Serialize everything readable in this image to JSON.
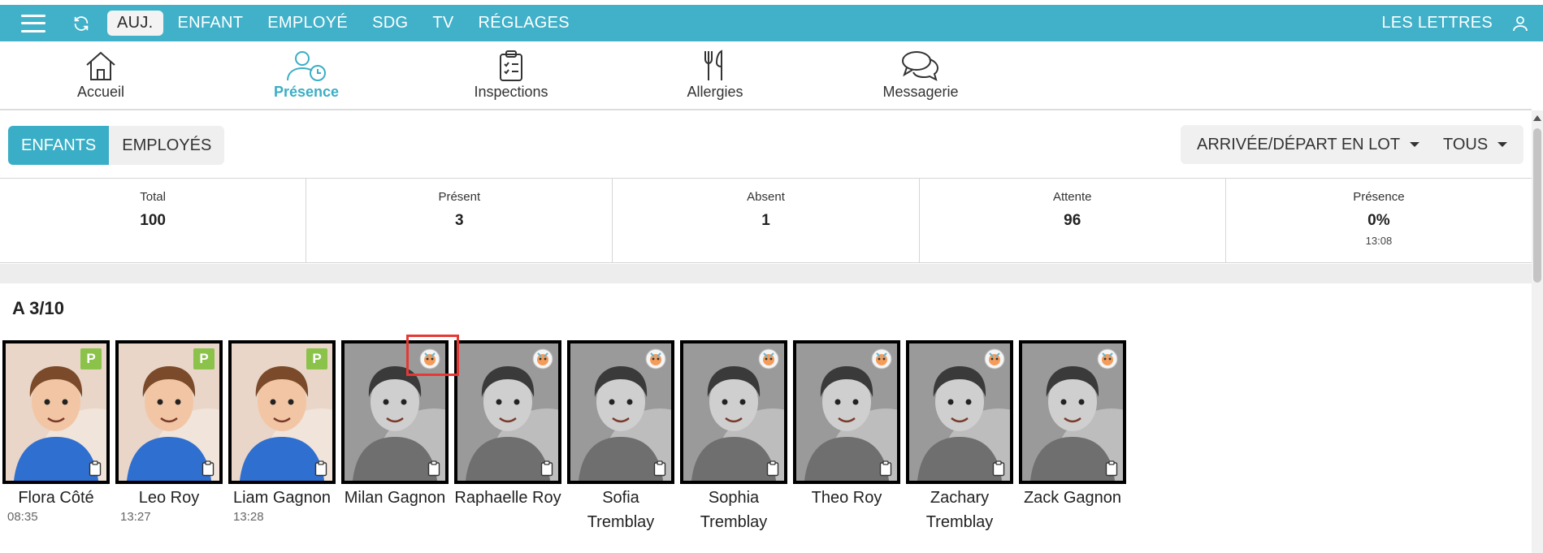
{
  "topbar": {
    "nav": [
      "AUJ.",
      "ENFANT",
      "EMPLOYÉ",
      "SDG",
      "TV",
      "RÉGLAGES"
    ],
    "right_label": "LES LETTRES"
  },
  "modules": [
    {
      "label": "Accueil",
      "icon": "home-icon"
    },
    {
      "label": "Présence",
      "icon": "attendance-icon"
    },
    {
      "label": "Inspections",
      "icon": "clipboard-icon"
    },
    {
      "label": "Allergies",
      "icon": "utensils-icon"
    },
    {
      "label": "Messagerie",
      "icon": "chat-icon"
    }
  ],
  "toggle": {
    "children": "ENFANTS",
    "employees": "EMPLOYÉS"
  },
  "actions": {
    "batch": "ARRIVÉE/DÉPART EN LOT",
    "filter": "TOUS"
  },
  "stats": [
    {
      "label": "Total",
      "value": "100",
      "time": ""
    },
    {
      "label": "Présent",
      "value": "3",
      "time": ""
    },
    {
      "label": "Absent",
      "value": "1",
      "time": ""
    },
    {
      "label": "Attente",
      "value": "96",
      "time": ""
    },
    {
      "label": "Présence",
      "value": "0%",
      "time": "13:08"
    }
  ],
  "group": {
    "title": "A 3/10",
    "children": [
      {
        "name": "Flora Côté",
        "time": "08:35",
        "status": "P"
      },
      {
        "name": "Leo Roy",
        "time": "13:27",
        "status": "P"
      },
      {
        "name": "Liam Gagnon",
        "time": "13:28",
        "status": "P"
      },
      {
        "name": "Milan Gagnon",
        "time": "",
        "status": ""
      },
      {
        "name": "Raphaelle Roy",
        "time": "",
        "status": ""
      },
      {
        "name": "Sofia Tremblay",
        "time": "",
        "status": ""
      },
      {
        "name": "Sophia Tremblay",
        "time": "",
        "status": ""
      },
      {
        "name": "Theo Roy",
        "time": "",
        "status": ""
      },
      {
        "name": "Zachary Tremblay",
        "time": "",
        "status": ""
      },
      {
        "name": "Zack Gagnon",
        "time": "",
        "status": ""
      }
    ]
  },
  "colors": {
    "brand": "#41b1c9",
    "active_tab": "#3aaec6",
    "present_badge": "#8bc34a",
    "highlight": "#e53935"
  }
}
